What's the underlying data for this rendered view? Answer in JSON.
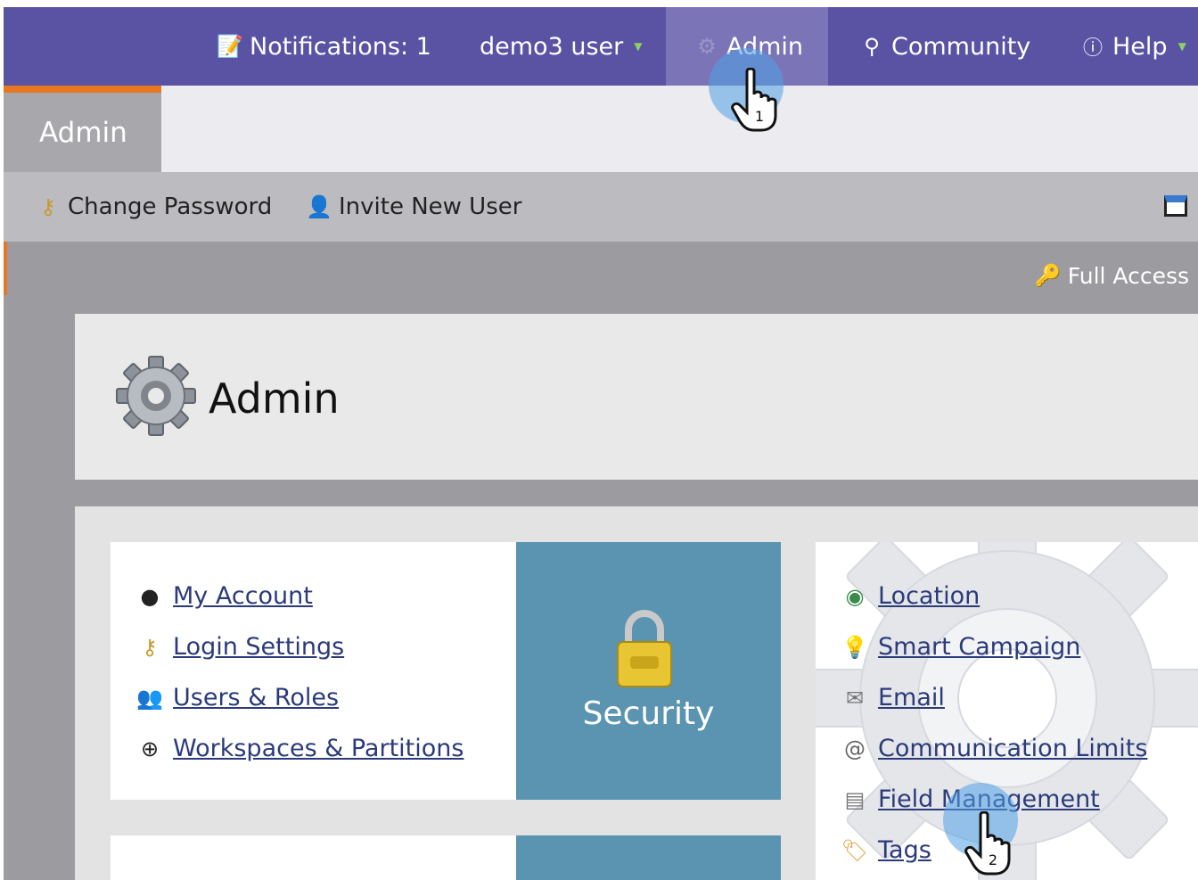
{
  "topbar": {
    "notifications": "Notifications: 1",
    "user": "demo3 user",
    "admin": "Admin",
    "community": "Community",
    "help": "Help"
  },
  "tabs": {
    "active": "Admin"
  },
  "toolbar": {
    "change_password": "Change Password",
    "invite_user": "Invite New User"
  },
  "access": "Full Access",
  "page_title": "Admin",
  "security_card": {
    "title": "Security",
    "links": [
      "My Account",
      "Login Settings",
      "Users & Roles",
      "Workspaces & Partitions"
    ]
  },
  "right_card": {
    "links": [
      "Location",
      "Smart Campaign",
      "Email",
      "Communication Limits",
      "Field Management",
      "Tags"
    ]
  },
  "cursors": {
    "step1": "1",
    "step2": "2"
  },
  "colors": {
    "topbar": "#5a53a3",
    "accent": "#e87722",
    "security": "#5a94b1",
    "link": "#2b3b7a"
  }
}
